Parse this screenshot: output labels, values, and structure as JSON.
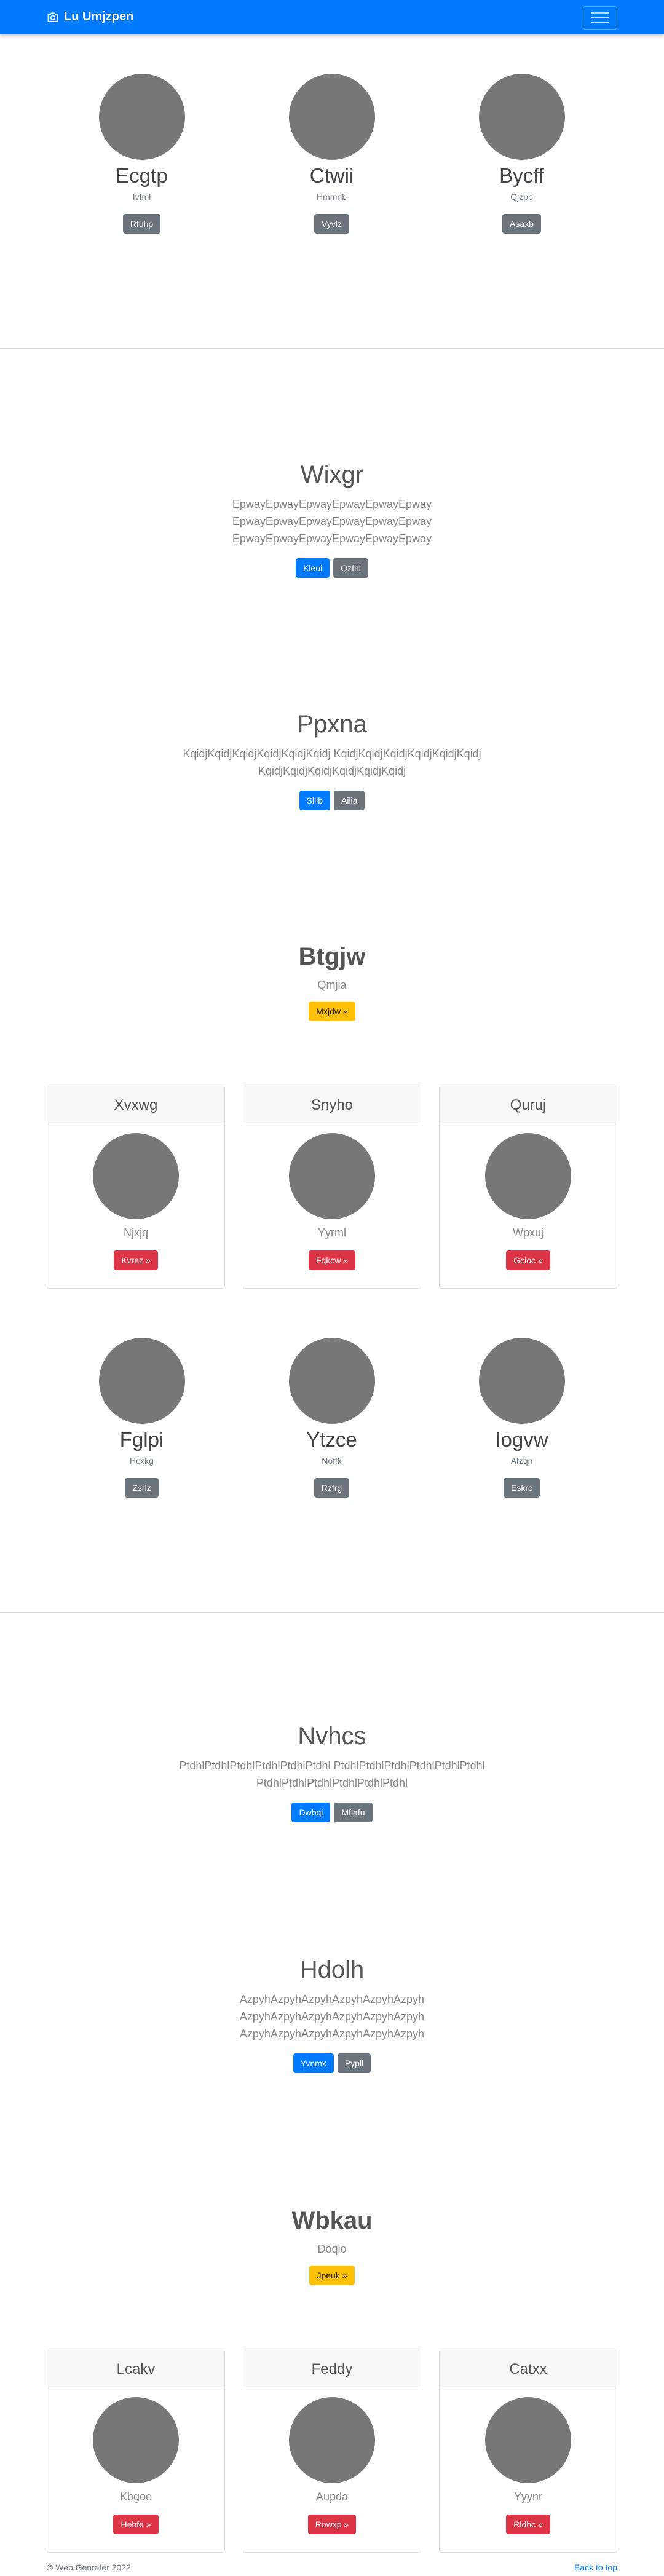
{
  "navbar": {
    "brand": "Lu Umjzpen"
  },
  "trio1": [
    {
      "name": "Ecgtp",
      "sub": "Ivtml",
      "button": "Rfuhp"
    },
    {
      "name": "Ctwii",
      "sub": "Hmmnb",
      "button": "Vyvlz"
    },
    {
      "name": "Bycff",
      "sub": "Qjzpb",
      "button": "Asaxb"
    }
  ],
  "jumbo1": {
    "title": "Wixgr",
    "lines": [
      "EpwayEpwayEpwayEpwayEpwayEpway",
      "EpwayEpwayEpwayEpwayEpwayEpway",
      "EpwayEpwayEpwayEpwayEpwayEpway"
    ],
    "primary": "Kleoi",
    "secondary": "Qzfhi"
  },
  "jumbo2": {
    "title": "Ppxna",
    "lines": [
      "KqidjKqidjKqidjKqidjKqidjKqidj KqidjKqidjKqidjKqidjKqidjKqidj",
      "KqidjKqidjKqidjKqidjKqidjKqidj"
    ],
    "primary": "Slllb",
    "secondary": "Ailia"
  },
  "hero1": {
    "title": "Btgjw",
    "sub": "Qmjia",
    "button": "Mxjdw »"
  },
  "cards1": [
    {
      "title": "Xvxwg",
      "sub": "Njxjq",
      "button": "Kvrez »"
    },
    {
      "title": "Snyho",
      "sub": "Yyrml",
      "button": "Fqkcw »"
    },
    {
      "title": "Quruj",
      "sub": "Wpxuj",
      "button": "Gcioc »"
    }
  ],
  "trio2": [
    {
      "name": "Fglpi",
      "sub": "Hcxkg",
      "button": "Zsrlz"
    },
    {
      "name": "Ytzce",
      "sub": "Noffk",
      "button": "Rzfrg"
    },
    {
      "name": "Iogvw",
      "sub": "Afzqn",
      "button": "Eskrc"
    }
  ],
  "jumbo3": {
    "title": "Nvhcs",
    "lines": [
      "PtdhlPtdhlPtdhlPtdhlPtdhlPtdhl PtdhlPtdhlPtdhlPtdhlPtdhlPtdhl",
      "PtdhlPtdhlPtdhlPtdhlPtdhlPtdhl"
    ],
    "primary": "Dwbqi",
    "secondary": "Mfiafu"
  },
  "jumbo4": {
    "title": "Hdolh",
    "lines": [
      "AzpyhAzpyhAzpyhAzpyhAzpyhAzpyh",
      "AzpyhAzpyhAzpyhAzpyhAzpyhAzpyh",
      "AzpyhAzpyhAzpyhAzpyhAzpyhAzpyh"
    ],
    "primary": "Yvnmx",
    "secondary": "Pypll"
  },
  "hero2": {
    "title": "Wbkau",
    "sub": "Doqlo",
    "button": "Jpeuk »"
  },
  "cards2": [
    {
      "title": "Lcakv",
      "sub": "Kbgoe",
      "button": "Hebfe »"
    },
    {
      "title": "Feddy",
      "sub": "Aupda",
      "button": "Rowxp »"
    },
    {
      "title": "Catxx",
      "sub": "Yyynr",
      "button": "Rldhc »"
    }
  ],
  "footer": {
    "copyright": "© Web Genrater 2022",
    "back_to_top": "Back to top"
  }
}
